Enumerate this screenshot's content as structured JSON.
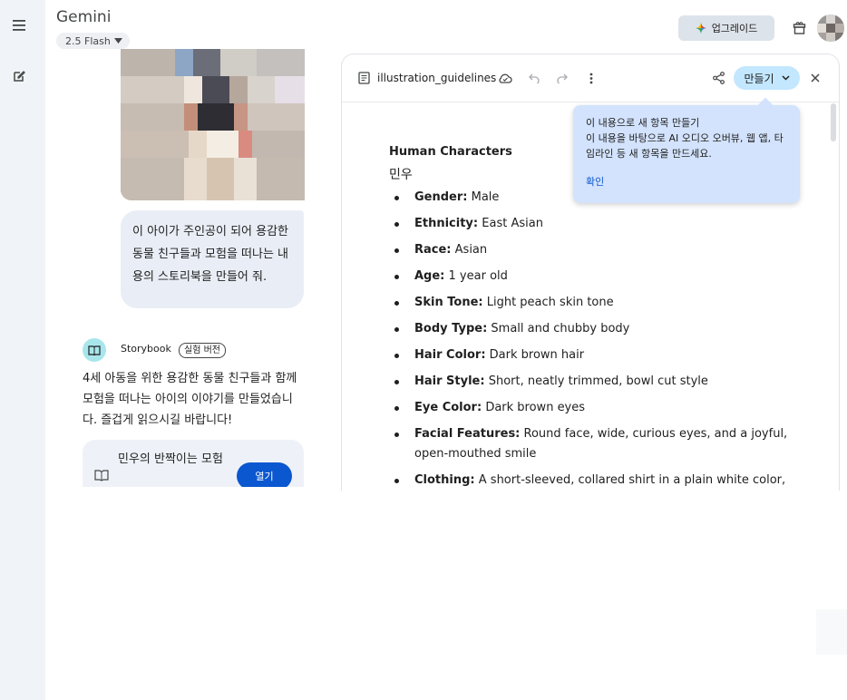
{
  "header": {
    "app_title": "Gemini",
    "model_label": "2.5 Flash",
    "upgrade_label": "업그레이드"
  },
  "chat": {
    "user_message": "이 아이가 주인공이 되어 용감한 동물 친구들과 모험을 떠나는 내용의 스토리북을 만들어 줘.",
    "bot_name": "Storybook",
    "bot_badge": "실험 버전",
    "bot_message": "4세 아동을 위한 용감한 동물 친구들과 함께 모험을 떠나는 아이의 이야기를 만들었습니다. 즐겁게 읽으시길 바랍니다!",
    "story_card": {
      "title": "민우의 반짝이는 모험",
      "open_label": "열기"
    }
  },
  "canvas": {
    "doc_name": "illustration_guidelines",
    "make_label": "만들기",
    "heading": "Human Characters",
    "character_name": "민우",
    "attributes": [
      {
        "label": "Gender:",
        "value": "Male"
      },
      {
        "label": "Ethnicity:",
        "value": "East Asian"
      },
      {
        "label": "Race:",
        "value": "Asian"
      },
      {
        "label": "Age:",
        "value": "1 year old"
      },
      {
        "label": "Skin Tone:",
        "value": "Light peach skin tone"
      },
      {
        "label": "Body Type:",
        "value": "Small and chubby body"
      },
      {
        "label": "Hair Color:",
        "value": "Dark brown hair"
      },
      {
        "label": "Hair Style:",
        "value": "Short, neatly trimmed, bowl cut style"
      },
      {
        "label": "Eye Color:",
        "value": "Dark brown eyes"
      },
      {
        "label": "Facial Features:",
        "value": "Round face, wide, curious eyes, and a joyful, open-mouthed smile"
      },
      {
        "label": "Clothing:",
        "value": "A short-sleeved, collared shirt in a plain white color, and"
      }
    ]
  },
  "tooltip": {
    "title": "이 내용으로 새 항목 만들기",
    "description": "이 내용을 바탕으로 AI 오디오 오버뷰, 웹 앱, 타임라인 등 새 항목을 만드세요.",
    "confirm_label": "확인"
  },
  "colors": {
    "accent_blue": "#0b57d0",
    "make_button": "#c2e7ff",
    "tooltip_bg": "#d3e3fd",
    "bubble_bg": "#e9eef6",
    "rail_bg": "#f0f4f9"
  },
  "icons": {
    "menu": "hamburger-icon",
    "new_chat": "edit-icon",
    "upgrade": "sparkle-icon",
    "gift": "gift-icon",
    "doc": "document-icon",
    "cloud": "cloud-icon",
    "undo": "undo-icon",
    "redo": "redo-icon",
    "more": "more-vert-icon",
    "share": "share-icon",
    "close": "close-icon",
    "storybook": "book-icon"
  }
}
